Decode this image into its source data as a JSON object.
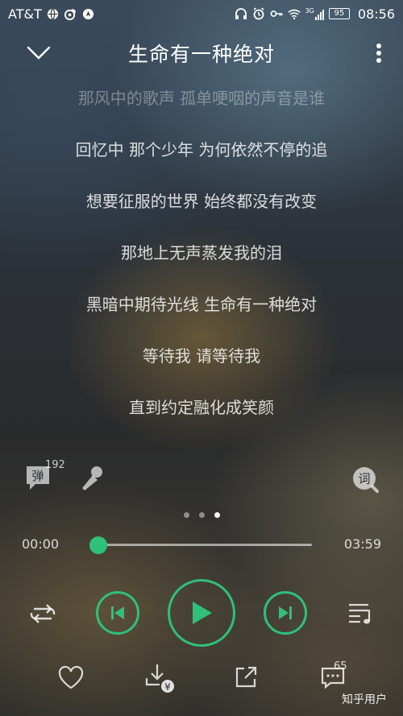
{
  "status_bar": {
    "carrier": "AT&T",
    "battery": "95",
    "network": "3G",
    "time": "08:56",
    "icons": [
      "browser-icon",
      "weibo-icon",
      "navigation-icon",
      "headphones-icon",
      "alarm-icon",
      "key-icon",
      "wifi-icon",
      "signal-icon",
      "battery-icon"
    ]
  },
  "header": {
    "title": "生命有一种绝对",
    "back_icon": "chevron-down-icon",
    "more_icon": "more-vertical-icon"
  },
  "lyrics": [
    "那风中的歌声 孤单哽咽的声音是谁",
    "回忆中 那个少年 为何依然不停的追",
    "想要征服的世界 始终都没有改变",
    "那地上无声蒸发我的泪",
    "黑暗中期待光线 生命有一种绝对",
    "等待我 请等待我",
    "直到约定融化成笑颜"
  ],
  "tools": {
    "danmaku_label": "弹",
    "danmaku_count": "192",
    "lyrics_label": "词"
  },
  "pager": {
    "total": 3,
    "active_index": 2
  },
  "playback": {
    "current_time": "00:00",
    "total_time": "03:59",
    "progress": 0
  },
  "bottom_actions": {
    "comment_count": "65",
    "download_badge": "¥"
  },
  "watermark": "知乎用户",
  "colors": {
    "accent": "#2fc07a"
  }
}
